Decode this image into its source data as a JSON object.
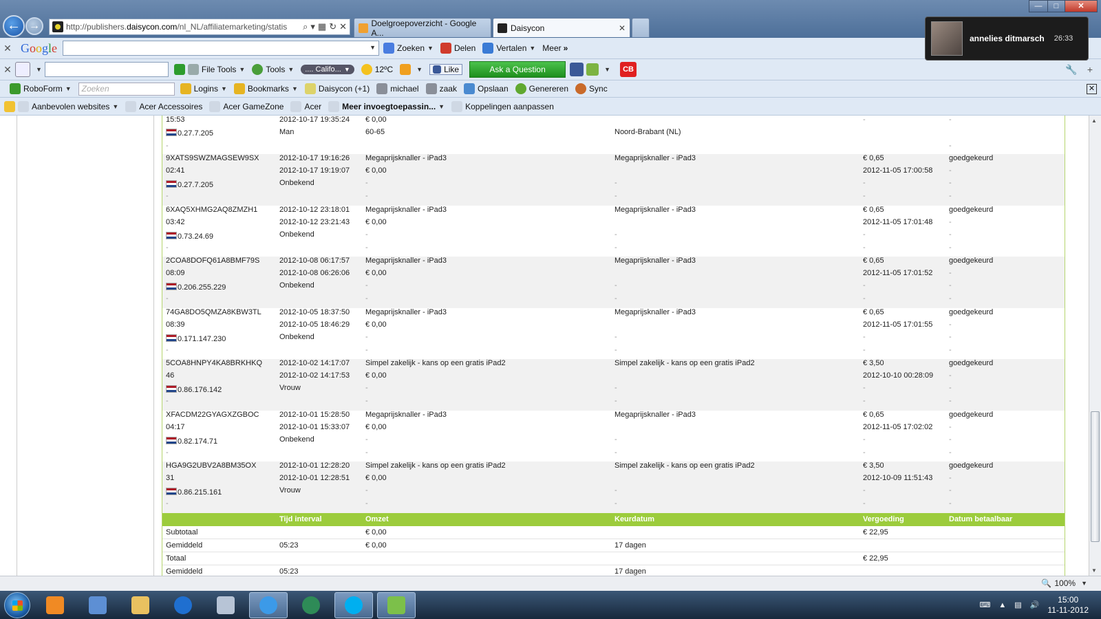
{
  "browser": {
    "url_prefix": "http://publishers.",
    "url_domain": "daisycon.com",
    "url_suffix": "/nl_NL/affiliatemarketing/statis",
    "tabs": [
      {
        "label": "Doelgroepoverzicht - Google A..."
      },
      {
        "label": "Daisycon"
      }
    ]
  },
  "chat_popup": {
    "name": "annelies ditmarsch",
    "time": "26:33"
  },
  "google_toolbar": {
    "search_label": "Zoeken",
    "share_label": "Delen",
    "translate_label": "Vertalen",
    "more_label": "Meer"
  },
  "tools_toolbar": {
    "file_tools_label": "File Tools",
    "tools_label": "Tools",
    "radio_label": ".... Califo...",
    "weather": "12ºC",
    "like_label": "Like",
    "ask_label": "Ask a Question",
    "cb_label": "CB"
  },
  "roboform_bar": {
    "roboform_label": "RoboForm",
    "search_placeholder": "Zoeken",
    "logins_label": "Logins",
    "bookmarks_label": "Bookmarks",
    "daisycon_label": "Daisycon (+1)",
    "michael_label": "michael",
    "zaak_label": "zaak",
    "save_label": "Opslaan",
    "generate_label": "Genereren",
    "sync_label": "Sync"
  },
  "favorites_bar": {
    "items": [
      "Aanbevolen websites",
      "Acer Accessoires",
      "Acer GameZone",
      "Acer",
      "Meer invoegtoepassin...",
      "Koppelingen aanpassen"
    ]
  },
  "table": {
    "first_row": {
      "id_tail": "15:53",
      "ip": "0.27.7.205",
      "date1": "2012-10-17 19:35:24",
      "gender": "Man",
      "omzet": "€ 0,00",
      "age": "60-65",
      "region": "Noord-Brabant (NL)"
    },
    "rows": [
      {
        "id1": "9XATS9SWZMAGSEW9SX",
        "id2": "02:41",
        "ip": "0.27.7.205",
        "d1": "2012-10-17 19:16:26",
        "d2": "2012-10-17 19:19:07",
        "who": "Onbekend",
        "campaign": "Megaprijsknaller - iPad3",
        "omzet": "€ 0,00",
        "program": "Megaprijsknaller - iPad3",
        "vergoeding": "€ 0,65",
        "keurdatum": "2012-11-05 17:00:58",
        "status": "goedgekeurd"
      },
      {
        "id1": "6XAQ5XHMG2AQ8ZMZH1",
        "id2": "03:42",
        "ip": "0.73.24.69",
        "d1": "2012-10-12 23:18:01",
        "d2": "2012-10-12 23:21:43",
        "who": "Onbekend",
        "campaign": "Megaprijsknaller - iPad3",
        "omzet": "€ 0,00",
        "program": "Megaprijsknaller - iPad3",
        "vergoeding": "€ 0,65",
        "keurdatum": "2012-11-05 17:01:48",
        "status": "goedgekeurd"
      },
      {
        "id1": "2COA8DOFQ61A8BMF79S",
        "id2": "08:09",
        "ip": "0.206.255.229",
        "d1": "2012-10-08 06:17:57",
        "d2": "2012-10-08 06:26:06",
        "who": "Onbekend",
        "campaign": "Megaprijsknaller - iPad3",
        "omzet": "€ 0,00",
        "program": "Megaprijsknaller - iPad3",
        "vergoeding": "€ 0,65",
        "keurdatum": "2012-11-05 17:01:52",
        "status": "goedgekeurd"
      },
      {
        "id1": "74GA8DO5QMZA8KBW3TL",
        "id2": "08:39",
        "ip": "0.171.147.230",
        "d1": "2012-10-05 18:37:50",
        "d2": "2012-10-05 18:46:29",
        "who": "Onbekend",
        "campaign": "Megaprijsknaller - iPad3",
        "omzet": "€ 0,00",
        "program": "Megaprijsknaller - iPad3",
        "vergoeding": "€ 0,65",
        "keurdatum": "2012-11-05 17:01:55",
        "status": "goedgekeurd"
      },
      {
        "id1": "5COA8HNPY4KA8BRKHKQ",
        "id2": "46",
        "ip": "0.86.176.142",
        "d1": "2012-10-02 14:17:07",
        "d2": "2012-10-02 14:17:53",
        "who": "Vrouw",
        "campaign": "Simpel zakelijk - kans op een gratis iPad2",
        "omzet": "€ 0,00",
        "program": "Simpel zakelijk - kans op een gratis iPad2",
        "vergoeding": "€ 3,50",
        "keurdatum": "2012-10-10 00:28:09",
        "status": "goedgekeurd"
      },
      {
        "id1": "XFACDM22GYAGXZGBOC",
        "id2": "04:17",
        "ip": "0.82.174.71",
        "d1": "2012-10-01 15:28:50",
        "d2": "2012-10-01 15:33:07",
        "who": "Onbekend",
        "campaign": "Megaprijsknaller - iPad3",
        "omzet": "€ 0,00",
        "program": "Megaprijsknaller - iPad3",
        "vergoeding": "€ 0,65",
        "keurdatum": "2012-11-05 17:02:02",
        "status": "goedgekeurd"
      },
      {
        "id1": "HGA9G2UBV2A8BM35OX",
        "id2": "31",
        "ip": "0.86.215.161",
        "d1": "2012-10-01 12:28:20",
        "d2": "2012-10-01 12:28:51",
        "who": "Vrouw",
        "campaign": "Simpel zakelijk - kans op een gratis iPad2",
        "omzet": "€ 0,00",
        "program": "Simpel zakelijk - kans op een gratis iPad2",
        "vergoeding": "€ 3,50",
        "keurdatum": "2012-10-09 11:51:43",
        "status": "goedgekeurd"
      }
    ],
    "dash": "-",
    "header": {
      "tijd_interval": "Tijd interval",
      "omzet": "Omzet",
      "keurdatum": "Keurdatum",
      "vergoeding": "Vergoeding",
      "datum_betaalbaar": "Datum betaalbaar"
    },
    "summary": [
      {
        "label": "Subtotaal",
        "interval": "",
        "omzet": "€ 0,00",
        "keurdatum": "",
        "vergoeding": "€ 22,95"
      },
      {
        "label": "Gemiddeld",
        "interval": "05:23",
        "omzet": "€ 0,00",
        "keurdatum": "17 dagen",
        "vergoeding": ""
      },
      {
        "label": "Totaal",
        "interval": "",
        "omzet": "",
        "keurdatum": "",
        "vergoeding": "€ 22,95"
      },
      {
        "label": "Gemiddeld",
        "interval": "05:23",
        "omzet": "",
        "keurdatum": "17 dagen",
        "vergoeding": ""
      }
    ]
  },
  "statusbar": {
    "zoom": "100%"
  },
  "taskbar": {
    "time": "15:00",
    "date": "11-11-2012"
  },
  "colors": {
    "accent_green": "#9ccc3c",
    "row_alt": "#f1f1f1",
    "ask_button": "#2ea02e"
  }
}
